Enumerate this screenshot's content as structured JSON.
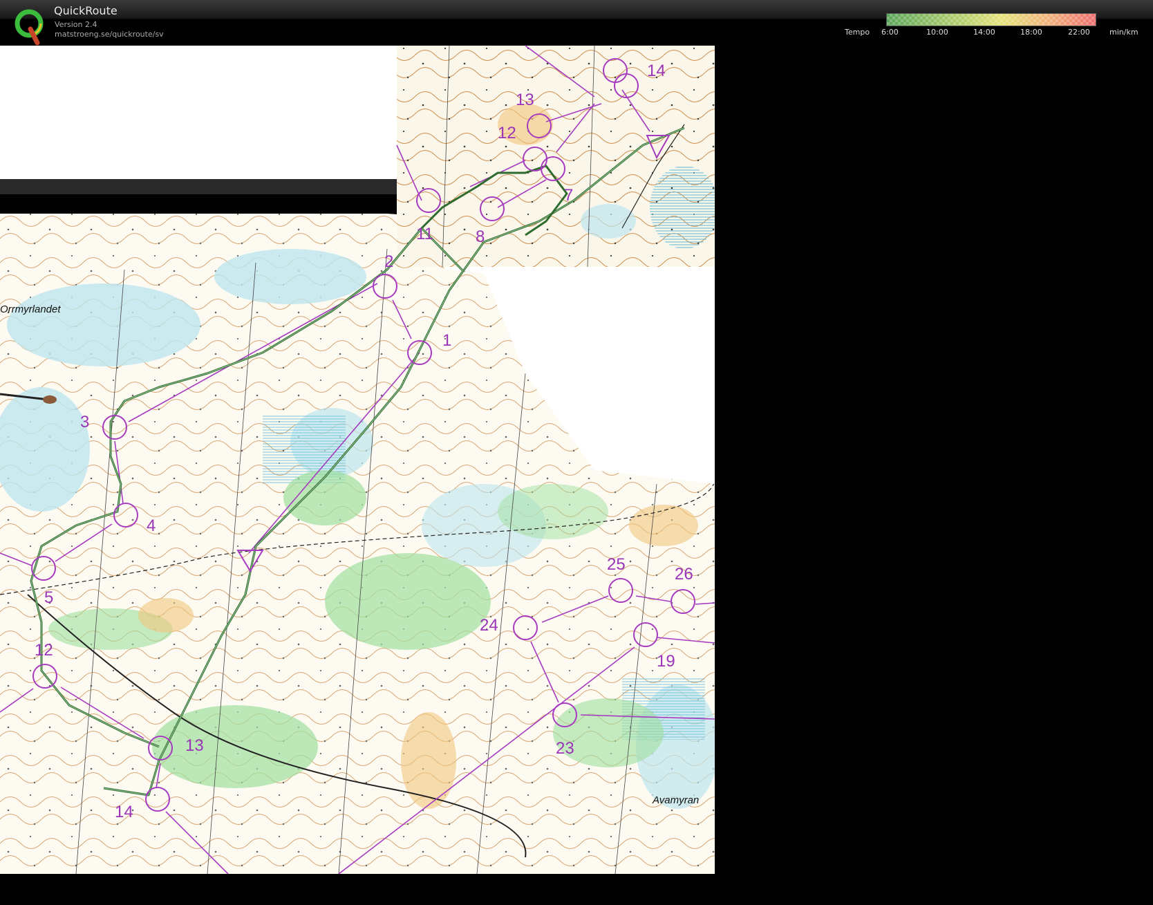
{
  "app": {
    "title": "QuickRoute",
    "version": "Version 2.4",
    "url": "matstroeng.se/quickroute/sv"
  },
  "tempo": {
    "label": "Tempo",
    "ticks": [
      "6:00",
      "10:00",
      "14:00",
      "18:00",
      "22:00"
    ],
    "unit": "min/km",
    "gradient_colors": [
      "#5aa65a",
      "#a7c96a",
      "#e4e37a",
      "#f1b07a",
      "#ee6e6e"
    ]
  },
  "map": {
    "controls_main": [
      "1",
      "2",
      "3",
      "4",
      "5",
      "12",
      "13",
      "14",
      "19",
      "23",
      "24",
      "25",
      "26"
    ],
    "controls_inset": [
      "7",
      "8",
      "11",
      "12",
      "13",
      "14"
    ],
    "place_names": [
      "Orrmyrlandet",
      "Avamyran"
    ],
    "colors": {
      "course": "#a63bc0",
      "route": "#2e6b2e",
      "vegetation": "#8fd68f",
      "marsh": "#7fd0e0",
      "contour": "#c8843c"
    }
  }
}
